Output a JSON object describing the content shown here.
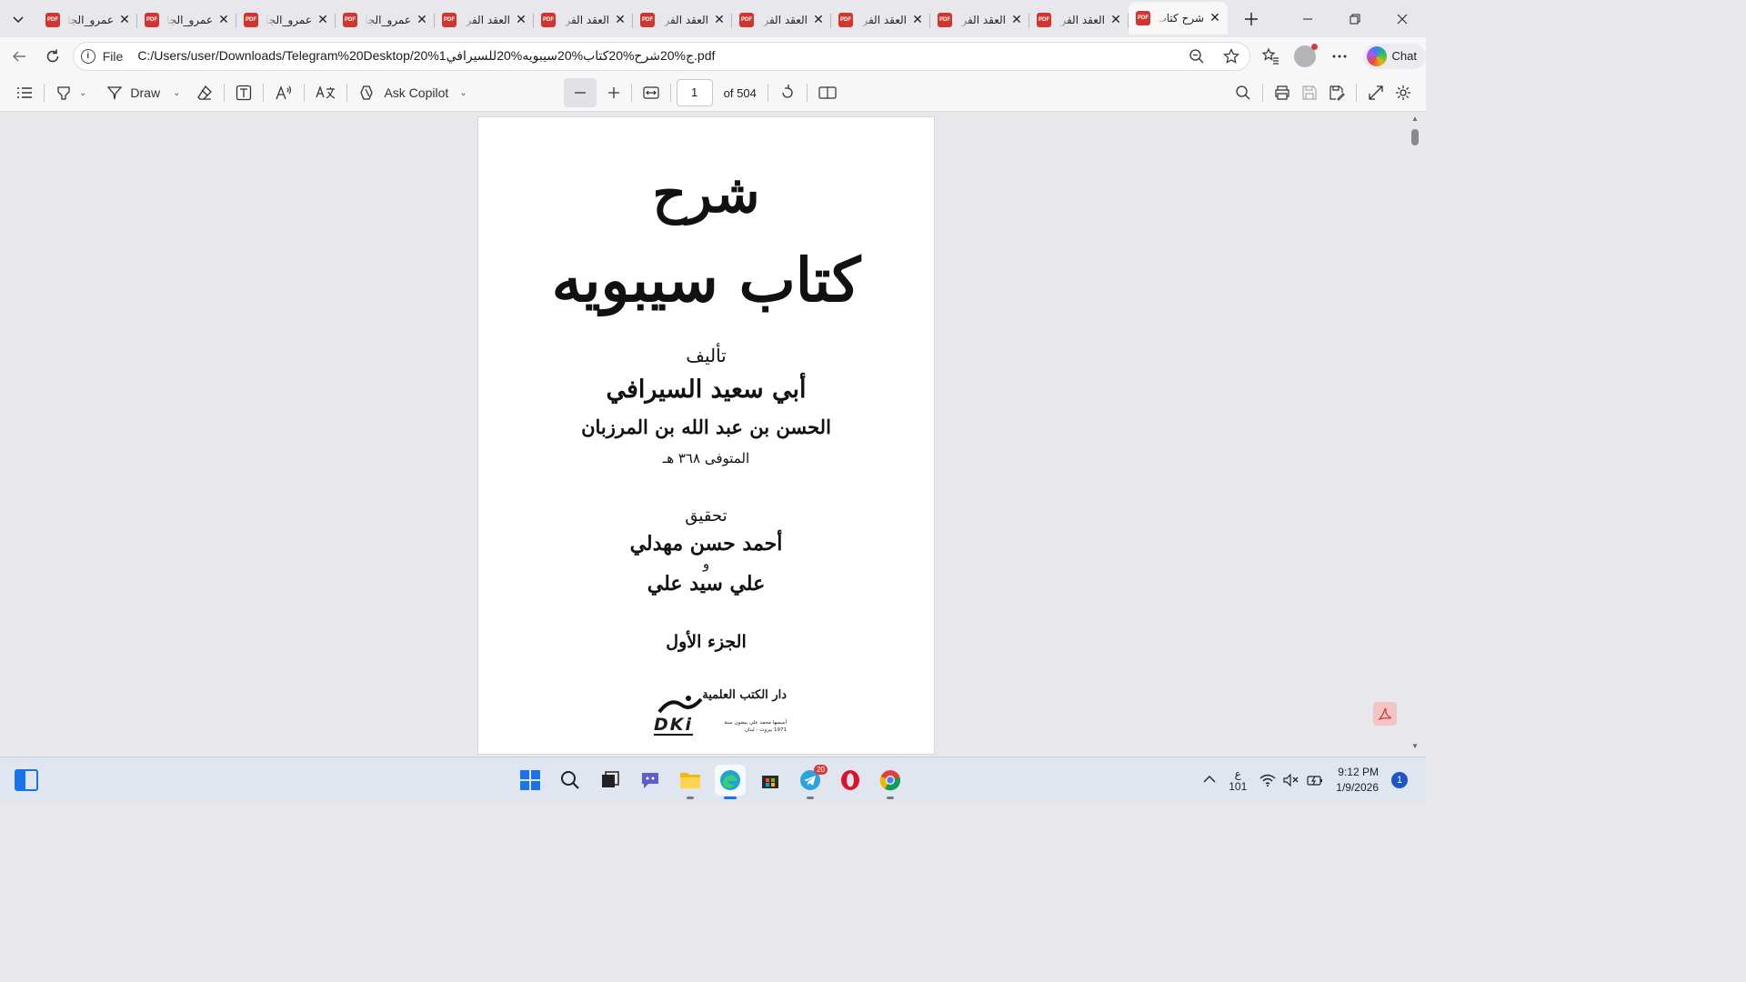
{
  "tabs": [
    {
      "title": "عمرو_الجا",
      "active": false
    },
    {
      "title": "عمرو_الجا",
      "active": false
    },
    {
      "title": "عمرو_الجا",
      "active": false
    },
    {
      "title": "عمرو_الجا",
      "active": false
    },
    {
      "title": "العقد الفر",
      "active": false
    },
    {
      "title": "العقد الفر",
      "active": false
    },
    {
      "title": "العقد الفر",
      "active": false
    },
    {
      "title": "العقد الفر",
      "active": false
    },
    {
      "title": "العقد الفر",
      "active": false
    },
    {
      "title": "العقد الفر",
      "active": false
    },
    {
      "title": "العقد الفر",
      "active": false
    },
    {
      "title": "شرح كتاب",
      "active": true
    }
  ],
  "tab_badge": "PDF",
  "address": {
    "scheme_label": "File",
    "url": "C:/Users/user/Downloads/Telegram%20Desktop/20%1ج%20شرح%20كتاب%20سيبويه%20للسيرافي.pdf"
  },
  "chat_label": "Chat",
  "pdf_toolbar": {
    "draw_label": "Draw",
    "copilot_label": "Ask Copilot",
    "page_current": "1",
    "page_total_label": "of 504"
  },
  "document": {
    "title_line1": "شرح",
    "title_line2": "كتاب سيبويه",
    "authored_label": "تأليف",
    "author_name": "أبي سعيد السيرافي",
    "author_full": "الحسن بن عبد الله بن المرزبان",
    "death_note": "المتوفى ٣٦٨ هـ",
    "edited_label": "تحقيق",
    "editor1": "أحمد حسن مهدلي",
    "and": "و",
    "editor2": "علي سيد علي",
    "volume": "الجزء الأول",
    "publisher_name": "دار الكتب العلمية",
    "publisher_abbr": "DKi",
    "publisher_founder": "أسسها محمد علي بيضون سنة 1971 بيروت - لبنان"
  },
  "taskbar": {
    "apps": [
      "start",
      "search",
      "task-view",
      "teams",
      "file-explorer",
      "edge",
      "store",
      "telegram",
      "opera",
      "chrome"
    ],
    "telegram_badge": "20",
    "lang_top": "ع",
    "lang_bottom": "101",
    "time": "9:12 PM",
    "date": "1/9/2026",
    "notification_count": "1"
  },
  "colors": {
    "pdf_red": "#d1352f",
    "accent": "#1a73e8"
  }
}
